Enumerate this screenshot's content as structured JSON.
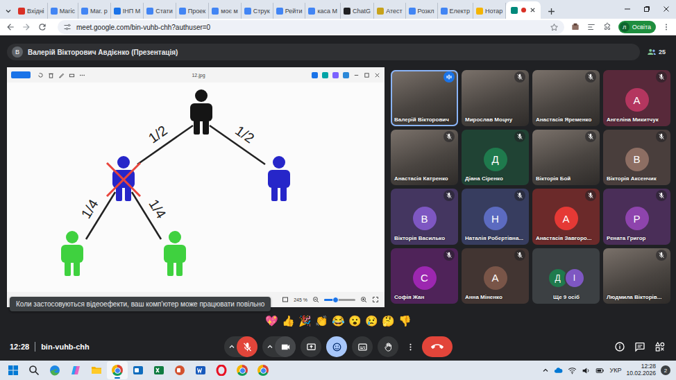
{
  "browser": {
    "tabs": [
      {
        "label": "Вхідні",
        "selected": false,
        "color": "#d93025"
      },
      {
        "label": "Магіс",
        "selected": false,
        "color": "#4285f4"
      },
      {
        "label": "Маг. р",
        "selected": false,
        "color": "#4285f4"
      },
      {
        "label": "ІНП М",
        "selected": false,
        "color": "#1a73e8"
      },
      {
        "label": "Стати",
        "selected": false,
        "color": "#4285f4"
      },
      {
        "label": "Проек",
        "selected": false,
        "color": "#4285f4"
      },
      {
        "label": "моє м",
        "selected": false,
        "color": "#4285f4"
      },
      {
        "label": "Струк",
        "selected": false,
        "color": "#4285f4"
      },
      {
        "label": "Рейти",
        "selected": false,
        "color": "#4285f4"
      },
      {
        "label": "каса М",
        "selected": false,
        "color": "#4285f4"
      },
      {
        "label": "ChatG",
        "selected": false,
        "color": "#202123"
      },
      {
        "label": "Атест",
        "selected": false,
        "color": "#c7a21a"
      },
      {
        "label": "Розкл",
        "selected": false,
        "color": "#4285f4"
      },
      {
        "label": "Електр",
        "selected": false,
        "color": "#4285f4"
      },
      {
        "label": "Нотар",
        "selected": false,
        "color": "#f4b400"
      },
      {
        "selected": true,
        "color": "#00897b",
        "recording": true
      }
    ],
    "url": "meet.google.com/bin-vuhb-chh?authuser=0",
    "bookmarked": false,
    "profile": {
      "initial": "Л",
      "label": "Освіта"
    }
  },
  "meet": {
    "header": {
      "initial": "В",
      "title": "Валерій Вікторович Авдієнко (Презентація)",
      "participants": "25"
    },
    "presentation": {
      "file": "12.jpg",
      "zoom": "245 %",
      "zoom_level": 0.35,
      "diagram": {
        "root": {
          "color": "#151515",
          "crossed": false,
          "children": [
            {
              "edge": "1/2",
              "color": "#2626c9",
              "crossed": true,
              "children": [
                {
                  "edge": "1/4",
                  "color": "#3fd13f",
                  "crossed": false,
                  "children": []
                },
                {
                  "edge": "1/4",
                  "color": "#3fd13f",
                  "crossed": false,
                  "children": []
                }
              ]
            },
            {
              "edge": "1/2",
              "color": "#2626c9",
              "crossed": false,
              "children": []
            }
          ]
        }
      }
    },
    "tooltip": "Коли застосовуються відеоефекти, ваш комп'ютер може працювати повільно",
    "tiles": [
      {
        "name": "Валерій Вікторович",
        "kind": "video",
        "muted": false,
        "speaking": true
      },
      {
        "name": "Мирослав Моцну",
        "kind": "video",
        "muted": true,
        "speaking": false
      },
      {
        "name": "Анастасія Яременко",
        "kind": "video",
        "muted": true,
        "speaking": false
      },
      {
        "name": "Ангеліна Микитчук",
        "kind": "avatar",
        "initial": "А",
        "color": "#b4365f",
        "muted": true,
        "speaking": false
      },
      {
        "name": "Анастасія Катренко",
        "kind": "video",
        "muted": true,
        "speaking": false
      },
      {
        "name": "Діана Сіренко",
        "kind": "avatar",
        "initial": "Д",
        "color": "#1f7a4d",
        "muted": true,
        "speaking": false
      },
      {
        "name": "Вікторія Бой",
        "kind": "video",
        "muted": true,
        "speaking": false
      },
      {
        "name": "Вікторія Аксенчик",
        "kind": "avatar",
        "initial": "В",
        "color": "#8d6e63",
        "muted": true,
        "speaking": false
      },
      {
        "name": "Вікторія Василько",
        "kind": "avatar",
        "initial": "В",
        "color": "#7e57c2",
        "muted": true,
        "speaking": false
      },
      {
        "name": "Наталія Робертівна...",
        "kind": "avatar",
        "initial": "Н",
        "color": "#5c6bc0",
        "muted": true,
        "speaking": false
      },
      {
        "name": "Анастасія Завгоро...",
        "kind": "avatar",
        "initial": "А",
        "color": "#e53935",
        "muted": true,
        "speaking": false
      },
      {
        "name": "Рената Григор",
        "kind": "avatar",
        "initial": "Р",
        "color": "#8e44ad",
        "muted": true,
        "speaking": false
      },
      {
        "name": "Софія Жан",
        "kind": "avatar",
        "initial": "С",
        "color": "#9c27b0",
        "muted": true,
        "speaking": false
      },
      {
        "name": "Анна Міненко",
        "kind": "avatar",
        "initial": "А",
        "color": "#795548",
        "muted": true,
        "speaking": false
      },
      {
        "name": "Ще 9 осіб",
        "kind": "more",
        "initials": [
          {
            "initial": "Д",
            "color": "#1f7a4d"
          },
          {
            "initial": "І",
            "color": "#7e57c2"
          }
        ]
      },
      {
        "name": "Людмила Вікторів...",
        "kind": "video",
        "muted": true,
        "speaking": false
      }
    ],
    "reactions": [
      "💖",
      "👍",
      "🎉",
      "👏",
      "😂",
      "😮",
      "😢",
      "🤔",
      "👎"
    ],
    "time": "12:28",
    "code": "bin-vuhb-chh",
    "controls": {
      "mic_muted": true,
      "camera_off": false,
      "reactions_open": true
    }
  },
  "taskbar": {
    "apps": [
      {
        "kind": "start",
        "active": false
      },
      {
        "kind": "search",
        "active": false
      },
      {
        "kind": "edge",
        "active": false
      },
      {
        "kind": "copilot",
        "active": false
      },
      {
        "kind": "explorer",
        "active": false
      },
      {
        "kind": "chrome",
        "active": true
      },
      {
        "kind": "outlook",
        "active": false
      },
      {
        "kind": "excel",
        "active": false
      },
      {
        "kind": "powerpoint",
        "active": false
      },
      {
        "kind": "word",
        "active": false
      },
      {
        "kind": "opera",
        "active": false
      },
      {
        "kind": "chrome",
        "active": false
      },
      {
        "kind": "chrome",
        "active": false
      }
    ],
    "language": "УКР",
    "time": "12:28",
    "date": "10.02.2026",
    "notifications": "2"
  }
}
